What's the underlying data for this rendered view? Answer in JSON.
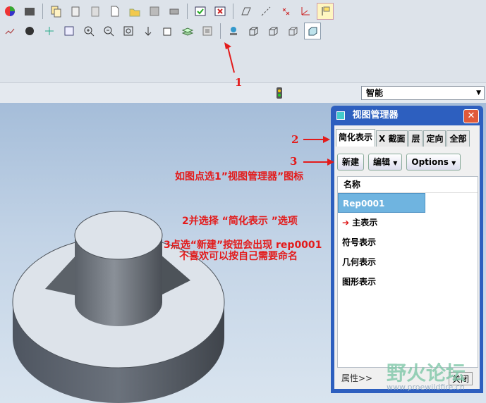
{
  "combo": {
    "value": "智能"
  },
  "dialog": {
    "title": "视图管理器",
    "close_glyph": "✕",
    "tabs": [
      "简化表示",
      "X 截面",
      "层",
      "定向",
      "全部"
    ],
    "buttons": {
      "new": "新建",
      "edit": "编辑",
      "options": "Options"
    },
    "list_header": "名称",
    "items": [
      "Rep0001",
      "主表示",
      "符号表示",
      "几何表示",
      "图形表示"
    ],
    "footer": {
      "attributes": "属性>>",
      "close": "关闭"
    }
  },
  "annotations": {
    "n1": "1",
    "n2": "2",
    "n3": "3",
    "line1": "如图点选1”视图管理器”图标",
    "line2": "2并选择 “简化表示 ”选项",
    "line3": "3点选“新建”按钮会出现 rep0001",
    "line4": "不喜欢可以按自己需要命名"
  },
  "watermark": {
    "text": "野火论坛",
    "url": "www.proewildfire.cn"
  },
  "colors": {
    "annotation": "#e31b1b",
    "selection": "#6fb4e0",
    "dialog_frame": "#2d5fbf"
  }
}
